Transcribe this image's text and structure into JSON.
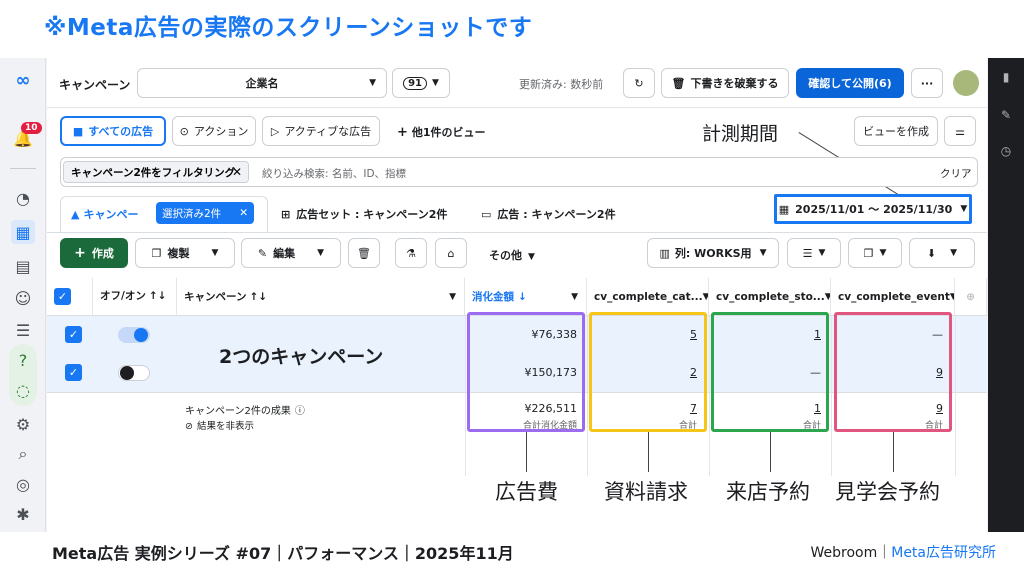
{
  "banner": "※Meta広告の実際のスクリーンショットです",
  "nav": {
    "notification_count": "10"
  },
  "header": {
    "title": "キャンペーン",
    "account_name": "企業名",
    "count_badge": "91",
    "updated": "更新済み: 数秒前",
    "discard_label": "下書きを破棄する",
    "publish_label": "確認して公開(6)",
    "more_label": "···"
  },
  "views": {
    "all_ads": "すべての広告",
    "action": "アクション",
    "active_ads": "アクティブな広告",
    "other_views": "他1件のビュー",
    "create_view": "ビューを作成"
  },
  "annotation_period": "計測期間",
  "filter": {
    "chip": "キャンペーン2件をフィルタリング",
    "placeholder": "絞り込み検索: 名前、ID、指標",
    "clear": "クリア"
  },
  "tabs": {
    "campaign": "キャンペー",
    "selected": "選択済み2件",
    "adset": "広告セット : キャンペーン2件",
    "ad": "広告 : キャンペーン2件",
    "date_range": "2025/11/01 〜 2025/11/30"
  },
  "toolbar": {
    "create": "作成",
    "duplicate": "複製",
    "edit": "編集",
    "other": "その他",
    "columns": "列: WORKS用"
  },
  "table": {
    "headers": [
      "オフ/オン",
      "キャンペーン",
      "消化金額",
      "cv_complete_cat...",
      "cv_complete_sto...",
      "cv_complete_event"
    ],
    "overlay_label": "2つのキャンペーン",
    "rows": [
      {
        "spend": "¥76,338",
        "cat": "5",
        "sto": "1",
        "event": "—"
      },
      {
        "spend": "¥150,173",
        "cat": "2",
        "sto": "—",
        "event": "9"
      }
    ],
    "summary": {
      "label": "キャンペーン2件の成果",
      "hidden_note": "結果を非表示",
      "spend": "¥226,511",
      "spend_sub": "合計消化金額",
      "cat": "7",
      "cat_sub": "合計",
      "sto": "1",
      "sto_sub": "合計",
      "event": "9",
      "event_sub": "合計"
    }
  },
  "callouts": {
    "spend": "広告費",
    "docs": "資料請求",
    "visit": "来店予約",
    "tour": "見学会予約"
  },
  "footer": {
    "left": "Meta広告 実例シリーズ #07｜パフォーマンス｜2025年11月",
    "right_brand": "Webroom｜",
    "right_accent": "Meta広告研究所"
  },
  "colors": {
    "accent": "#1877f2",
    "spend_box": "#9b6cf0",
    "docs_box": "#f5c518",
    "visit_box": "#2da44e",
    "tour_box": "#e0567e",
    "period_box": "#1877f2"
  }
}
